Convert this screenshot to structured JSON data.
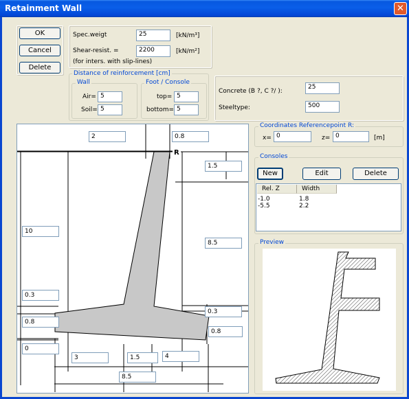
{
  "window": {
    "title": "Retainment Wall",
    "close_glyph": "✕"
  },
  "buttons": {
    "ok": "OK",
    "cancel": "Cancel",
    "delete": "Delete"
  },
  "material": {
    "spec_weight_label": "Spec.weigt",
    "spec_weight_value": "25",
    "spec_weight_unit": "[kN/m³]",
    "shear_label": "Shear-resist. =",
    "shear_value": "2200",
    "shear_unit": "[kN/m²]",
    "shear_note": "(for inters. with slip-lines)"
  },
  "reinforcement": {
    "title": "Distance of reinforcement [cm]",
    "wall": {
      "title": "Wall",
      "air_label": "Air=",
      "air_value": "5",
      "soil_label": "Soil=",
      "soil_value": "5"
    },
    "foot": {
      "title": "Foot / Console",
      "top_label": "top=",
      "top_value": "5",
      "bottom_label": "bottom=",
      "bottom_value": "5"
    }
  },
  "concrete": {
    "label": "Concrete (B ?, C ?/ ):",
    "value": "25",
    "steel_label": "Steeltype:",
    "steel_value": "500"
  },
  "coords": {
    "title": "Coordinates Referencepoint R:",
    "x_label": "x=",
    "x_value": "0",
    "z_label": "z=",
    "z_value": "0",
    "unit": "[m]"
  },
  "consoles": {
    "title": "Consoles",
    "new_label": "New",
    "edit_label": "Edit",
    "delete_label": "Delete",
    "columns": [
      "Rel. Z",
      "Width"
    ],
    "rows": [
      {
        "rel_z": "-1.0",
        "width": "1.8"
      },
      {
        "rel_z": "-5.5",
        "width": "2.2"
      }
    ]
  },
  "preview": {
    "title": "Preview"
  },
  "drawing": {
    "ref_label": "R",
    "dims": {
      "top_left_width": "2",
      "top_width": "0.8",
      "head_height": "1.5",
      "left_height": "10",
      "right_height": "8.5",
      "toe_offset": "0.3",
      "toe_thickness": "0.8",
      "toe_bottom": "0",
      "heel_offset": "0.3",
      "heel_thickness": "0.8",
      "toe_length": "3",
      "stem_base": "1.5",
      "heel_length": "4",
      "total_base": "8.5"
    }
  }
}
